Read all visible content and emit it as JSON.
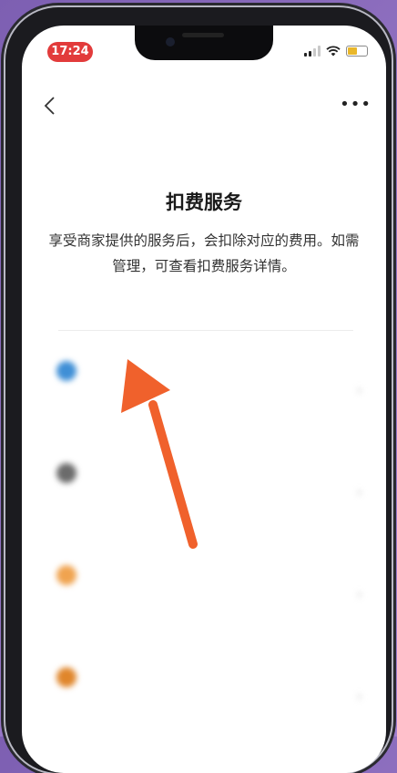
{
  "status_bar": {
    "time": "17:24"
  },
  "page": {
    "title": "扣费服务",
    "description": "享受商家提供的服务后，会扣除对应的费用。如需管理，可查看扣费服务详情。"
  },
  "services": [
    {
      "icon": "globe-icon",
      "color": "#3f8fd6",
      "name": "",
      "tag": "",
      "sub": "",
      "date": ""
    },
    {
      "icon": "apple-icon",
      "color": "#6b6b6b",
      "name": "",
      "tag": "",
      "sub": "",
      "date": ""
    },
    {
      "icon": "app-icon",
      "color": "#f0a34f",
      "name": "",
      "tag": "",
      "sub": "",
      "date": ""
    },
    {
      "icon": "app-icon",
      "color": "#e0862b",
      "name": "",
      "tag": "",
      "sub": "",
      "date": ""
    }
  ],
  "colors": {
    "time_pill": "#e23b3b",
    "annotation_arrow": "#f0612c",
    "tag_bg": "#f3e09a"
  }
}
